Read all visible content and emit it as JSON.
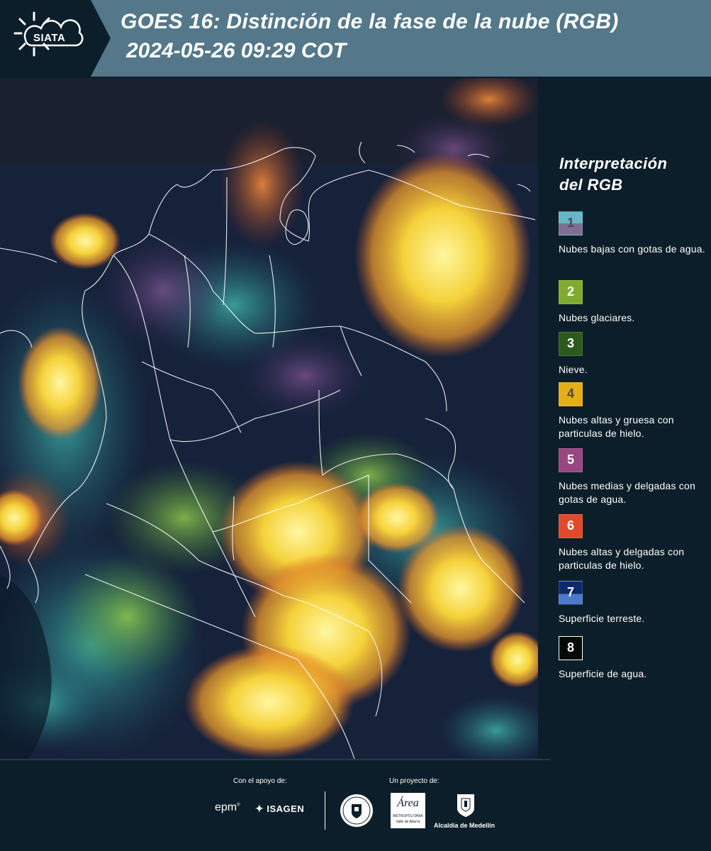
{
  "header": {
    "logo_text": "SIATA",
    "title_line1": "GOES 16: Distinción de la fase de la nube (RGB)",
    "title_line2": "2024-05-26 09:29 COT",
    "bg_color": "#54788a"
  },
  "legend": {
    "title_line1": "Interpretación",
    "title_line2": "del RGB",
    "items": [
      {
        "num": "1",
        "label": "Nubes bajas con gotas de agua.",
        "color_top": "#67b8c6",
        "color_bottom": "#7e6f92",
        "num_color": "#4a4a5a"
      },
      {
        "num": "2",
        "label": "Nubes glaciares.",
        "color_top": "#7fac2f",
        "color_bottom": "#7fac2f",
        "num_color": "#ffffff"
      },
      {
        "num": "3",
        "label": "Nieve.",
        "color_top": "#2d5a1c",
        "color_bottom": "#2d5a1c",
        "num_color": "#ffffff"
      },
      {
        "num": "4",
        "label": "Nubes altas y gruesa con particulas de hielo.",
        "color_top": "#e5ad17",
        "color_bottom": "#e5ad17",
        "num_color": "#4a4a4a"
      },
      {
        "num": "5",
        "label": "Nubes medias y delgadas con gotas de agua.",
        "color_top": "#9a4680",
        "color_bottom": "#9a4680",
        "num_color": "#ffffff"
      },
      {
        "num": "6",
        "label": "Nubes altas y delgadas con particulas de hielo.",
        "color_top": "#e04a2a",
        "color_bottom": "#e04a2a",
        "num_color": "#ffffff"
      },
      {
        "num": "7",
        "label": "Superficie terreste.",
        "color_top": "#0f2a6a",
        "color_bottom": "#4e78c8",
        "num_color": "#ffffff"
      },
      {
        "num": "8",
        "label": "Superficie de agua.",
        "color_top": "#050a05",
        "color_bottom": "#050a05",
        "num_color": "#ffffff"
      }
    ]
  },
  "footer": {
    "support_label": "Con el apoyo de:",
    "project_label": "Un proyecto de:",
    "epm": "epm",
    "isagen": "ISAGEN",
    "area_script": "Área",
    "area_sub1": "METROPOLITANA",
    "area_sub2": "Valle de Aburrá",
    "alcaldia": "Alcaldía de Medellín"
  }
}
